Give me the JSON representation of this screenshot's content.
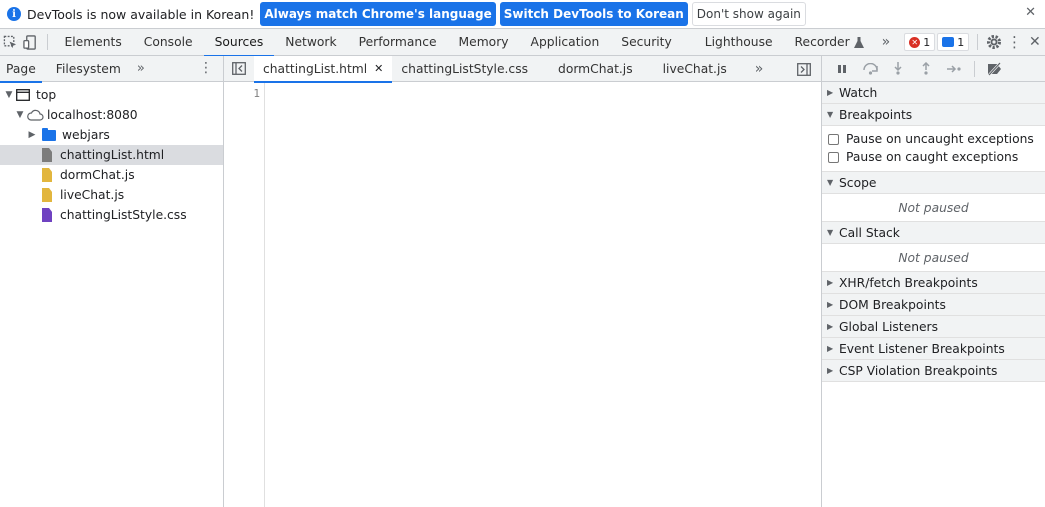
{
  "infobar": {
    "message": "DevTools is now available in Korean!",
    "btn_match": "Always match Chrome's language",
    "btn_switch": "Switch DevTools to Korean",
    "btn_dismiss": "Don't show again",
    "close": "✕",
    "info_glyph": "i"
  },
  "toolbar": {
    "tabs": [
      "Elements",
      "Console",
      "Sources",
      "Network",
      "Performance",
      "Memory",
      "Application",
      "Security",
      "Lighthouse",
      "Recorder"
    ],
    "active_tab": "Sources",
    "more": "»",
    "error_count": "1",
    "message_count": "1",
    "kebab": "⋮",
    "close": "✕"
  },
  "navigator": {
    "tabs": [
      "Page",
      "Filesystem"
    ],
    "more": "»",
    "kebab": "⋮",
    "tree": {
      "top": "top",
      "host": "localhost:8080",
      "folder": "webjars",
      "files": [
        "chattingList.html",
        "dormChat.js",
        "liveChat.js",
        "chattingListStyle.css"
      ]
    }
  },
  "editor": {
    "tabs": [
      "chattingList.html",
      "chattingListStyle.css",
      "dormChat.js",
      "liveChat.js"
    ],
    "active_close": "✕",
    "more": "»",
    "line_number": "1"
  },
  "debugger": {
    "watch": "Watch",
    "breakpoints": "Breakpoints",
    "pause_uncaught": "Pause on uncaught exceptions",
    "pause_caught": "Pause on caught exceptions",
    "scope": "Scope",
    "scope_status": "Not paused",
    "call_stack": "Call Stack",
    "call_stack_status": "Not paused",
    "xhr": "XHR/fetch Breakpoints",
    "dom": "DOM Breakpoints",
    "global": "Global Listeners",
    "event": "Event Listener Breakpoints",
    "csp": "CSP Violation Breakpoints"
  },
  "colors": {
    "accent": "#1a73e8",
    "error": "#d93025",
    "html_file": "#7c7c7c",
    "js_file": "#e2b63e",
    "css_file": "#6f42c1"
  },
  "icons": {
    "toolbar": [
      "inspect-element-icon",
      "device-toolbar-icon",
      "gear-icon"
    ],
    "debugger": [
      "pause-icon",
      "step-over-icon",
      "step-into-icon",
      "step-out-icon",
      "step-icon",
      "deactivate-breakpoints-icon"
    ]
  }
}
